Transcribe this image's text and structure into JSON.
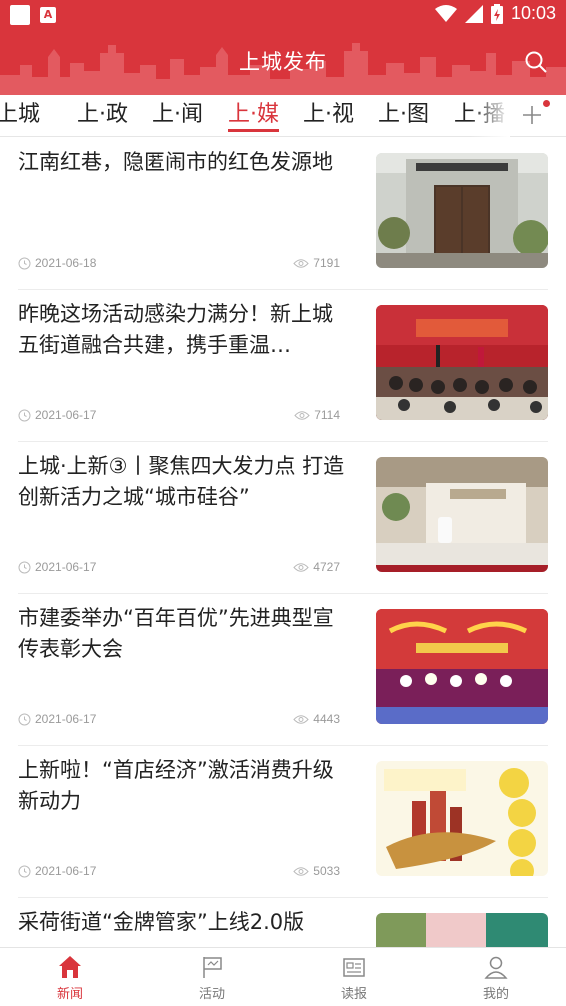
{
  "status_bar": {
    "time": "10:03"
  },
  "header": {
    "title": "上城发布"
  },
  "tabs": [
    {
      "label": "上城",
      "active": false
    },
    {
      "label": "上·政",
      "active": false
    },
    {
      "label": "上·闻",
      "active": false
    },
    {
      "label": "上·媒",
      "active": true
    },
    {
      "label": "上·视",
      "active": false
    },
    {
      "label": "上·图",
      "active": false
    },
    {
      "label": "上·播",
      "active": false
    }
  ],
  "colors": {
    "brand": "#d9353c",
    "text": "#222222",
    "meta": "#9a9a9a"
  },
  "articles": [
    {
      "title": "江南红巷，隐匿闹市的红色发源地",
      "date": "2021-06-18",
      "views": "7191",
      "thumb": "gate"
    },
    {
      "title": "昨晚这场活动感染力满分！新上城五街道融合共建，携手重温…",
      "date": "2021-06-17",
      "views": "7114",
      "thumb": "hall"
    },
    {
      "title": "上城·上新③丨聚焦四大发力点 打造创新活力之城“城市硅谷”",
      "date": "2021-06-17",
      "views": "4727",
      "thumb": "exhibit"
    },
    {
      "title": "市建委举办“百年百优”先进典型宣传表彰大会",
      "date": "2021-06-17",
      "views": "4443",
      "thumb": "stage"
    },
    {
      "title": "上新啦！“首店经济”激活消费升级新动力",
      "date": "2021-06-17",
      "views": "5033",
      "thumb": "infographic"
    },
    {
      "title": "采荷街道“金牌管家”上线2.0版",
      "date": "",
      "views": "",
      "thumb": "street"
    }
  ],
  "bottom_nav": [
    {
      "label": "新闻",
      "icon": "home-icon",
      "active": true
    },
    {
      "label": "活动",
      "icon": "flag-icon",
      "active": false
    },
    {
      "label": "读报",
      "icon": "newspaper-icon",
      "active": false
    },
    {
      "label": "我的",
      "icon": "user-icon",
      "active": false
    }
  ]
}
